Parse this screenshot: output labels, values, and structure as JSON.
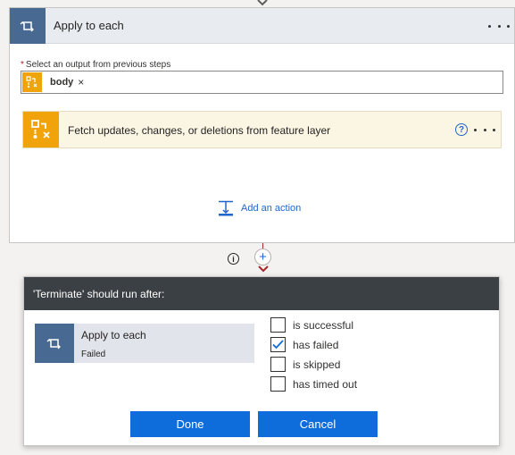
{
  "loop": {
    "title": "Apply to each",
    "icon": "loop-icon",
    "field_label": "Select an output from previous steps",
    "required_marker": "*",
    "token": {
      "label": "body",
      "remove": "×",
      "icon": "feature-layer-icon"
    }
  },
  "nested_action": {
    "title": "Fetch updates, changes, or deletions from feature layer",
    "help_glyph": "?",
    "icon": "feature-layer-icon"
  },
  "add_action": {
    "label": "Add an action",
    "icon": "add-action-icon"
  },
  "connector": {
    "info_glyph": "i",
    "plus_glyph": "+"
  },
  "run_after": {
    "title": "'Terminate' should run after:",
    "step": {
      "name": "Apply to each",
      "status": "Failed",
      "icon": "loop-icon"
    },
    "options": [
      {
        "label": "is successful",
        "checked": false
      },
      {
        "label": "has failed",
        "checked": true
      },
      {
        "label": "is skipped",
        "checked": false
      },
      {
        "label": "has timed out",
        "checked": false
      }
    ],
    "done_label": "Done",
    "cancel_label": "Cancel"
  },
  "colors": {
    "loop_blue": "#486991",
    "accent_orange": "#f0a30a",
    "link_blue": "#2266cc",
    "button_blue": "#0f6cdb",
    "panel_header": "#3b4044"
  }
}
